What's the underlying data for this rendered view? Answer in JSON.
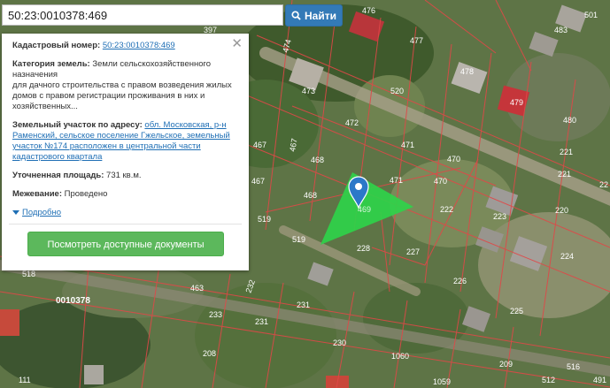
{
  "search": {
    "value": "50:23:0010378:469",
    "button_label": "Найти",
    "button_icon": "search-icon"
  },
  "info": {
    "cadastral_label": "Кадастровый номер:",
    "cadastral_value": "50:23:0010378:469",
    "category_label": "Категория земель:",
    "category_value": "Земли сельскохозяйственного назначения",
    "category_detail": "для дачного строительства с правом возведения жилых домов с правом регистрации проживания в них и хозяйственных...",
    "address_label": "Земельный участок по адресу:",
    "address_value": "обл. Московская, р-н Раменский, сельское поселение Гжельское, земельный участок №174 расположен в центральной части кадастрового квартала",
    "area_label": "Уточненная площадь:",
    "area_value": "731 кв.м.",
    "boundary_label": "Межевание:",
    "boundary_value": "Проведено",
    "more_label": "Подробно",
    "docs_button": "Посмотреть доступные документы",
    "close_icon": "close-icon"
  },
  "map": {
    "marker_icon": "map-pin-icon",
    "highlight_color": "#2fd24a",
    "parcel_line_color": "#e04848",
    "quarter_label": "0010378",
    "parcel_numbers": [
      "476",
      "477",
      "483",
      "478",
      "474",
      "473",
      "520",
      "479",
      "480",
      "472",
      "471",
      "470",
      "221",
      "467",
      "468",
      "469",
      "222",
      "223",
      "220",
      "519",
      "228",
      "227",
      "224",
      "518",
      "463",
      "226",
      "232",
      "231",
      "233",
      "225",
      "230",
      "208",
      "1060",
      "209",
      "111",
      "1059",
      "397",
      "516",
      "512",
      "491",
      "501"
    ]
  }
}
